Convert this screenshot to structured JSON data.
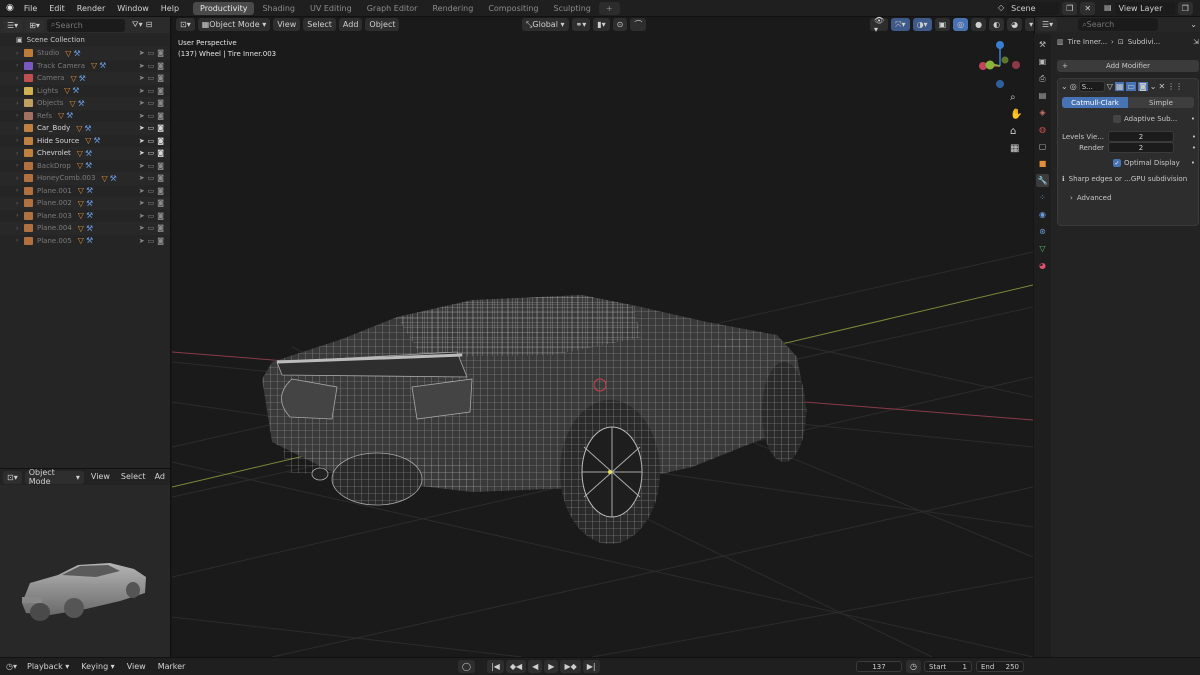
{
  "top_menu": [
    "File",
    "Edit",
    "Render",
    "Window",
    "Help"
  ],
  "workspace_tabs": [
    "Productivity",
    "Shading",
    "UV Editing",
    "Graph Editor",
    "Rendering",
    "Compositing",
    "Sculpting"
  ],
  "active_workspace": "Productivity",
  "scene_name": "Scene",
  "view_layer": "View Layer",
  "outliner": {
    "search_placeholder": "Search",
    "root": "Scene Collection",
    "items": [
      {
        "name": "Studio",
        "color": "#c07a3a",
        "dim": true
      },
      {
        "name": "Track Camera",
        "color": "#7a5ac0",
        "dim": true
      },
      {
        "name": "Camera",
        "color": "#c05050",
        "dim": true
      },
      {
        "name": "Lights",
        "color": "#d0b050",
        "dim": true
      },
      {
        "name": "Objects",
        "color": "#c0a060",
        "dim": true
      },
      {
        "name": "Refs",
        "color": "#a07060",
        "dim": true
      },
      {
        "name": "Car_Body",
        "color": "#c08040",
        "dim": false
      },
      {
        "name": "Hide Source",
        "color": "#c08040",
        "dim": false
      },
      {
        "name": "Chevrolet",
        "color": "#c08040",
        "dim": false
      },
      {
        "name": "BackDrop",
        "color": "#b07040",
        "dim": true
      },
      {
        "name": "HoneyComb.003",
        "color": "#b07040",
        "dim": true
      },
      {
        "name": "Plane.001",
        "color": "#b07040",
        "dim": true
      },
      {
        "name": "Plane.002",
        "color": "#b07040",
        "dim": true
      },
      {
        "name": "Plane.003",
        "color": "#b07040",
        "dim": true
      },
      {
        "name": "Plane.004",
        "color": "#b07040",
        "dim": true
      },
      {
        "name": "Plane.005",
        "color": "#b07040",
        "dim": true
      }
    ]
  },
  "preview_header": {
    "mode": "Object Mode",
    "view": "View",
    "select": "Select",
    "add": "Ad"
  },
  "viewport": {
    "mode": "Object Mode",
    "menus": [
      "View",
      "Select",
      "Add",
      "Object"
    ],
    "orientation": "Global",
    "overlay_title": "User Perspective",
    "overlay_object": "(137) Wheel | Tire Inner.003"
  },
  "properties": {
    "search_placeholder": "Search",
    "breadcrumb_object": "Tire Inner...",
    "breadcrumb_modifier": "Subdivi...",
    "add_modifier": "Add Modifier",
    "modifier_name": "S...",
    "tab_catmull": "Catmull-Clark",
    "tab_simple": "Simple",
    "adaptive": "Adaptive Sub...",
    "levels_label": "Levels Vie...",
    "levels_value": "2",
    "render_label": "Render",
    "render_value": "2",
    "optimal_display": "Optimal Display",
    "info_text": "Sharp edges or ...GPU subdivision",
    "advanced": "Advanced"
  },
  "timeline": {
    "playback": "Playback",
    "keying": "Keying",
    "view": "View",
    "marker": "Marker",
    "current_frame": "137",
    "start_label": "Start",
    "start_value": "1",
    "end_label": "End",
    "end_value": "250"
  },
  "colors": {
    "accent": "#4772b3",
    "x_axis": "#c0455a",
    "y_axis": "#8ab43a",
    "z_axis": "#3a7ed4"
  }
}
